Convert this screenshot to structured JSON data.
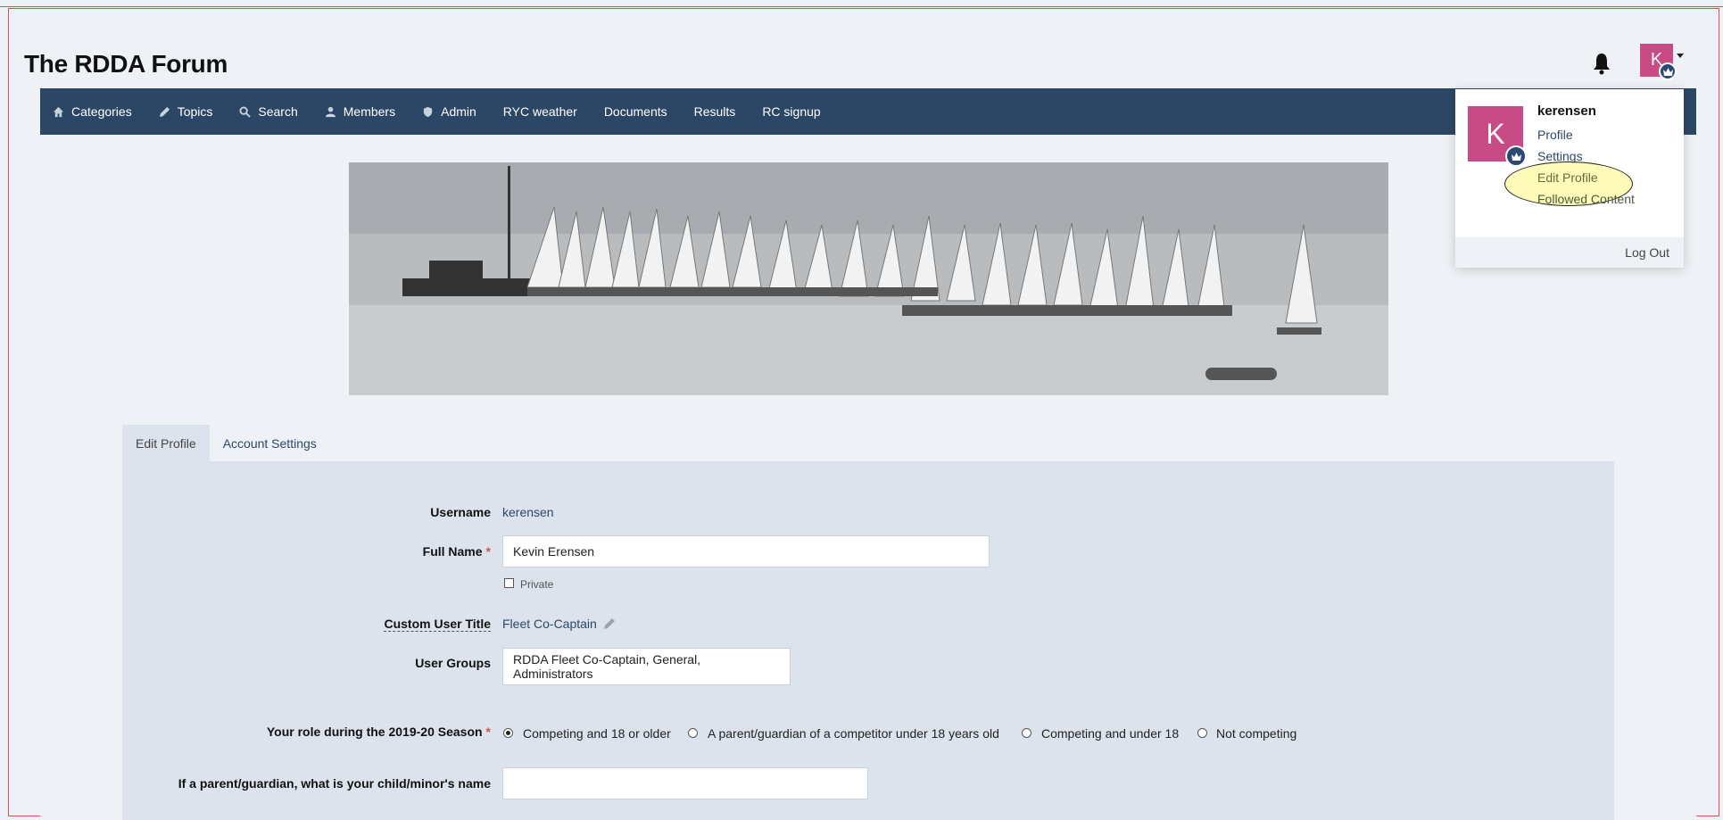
{
  "site": {
    "title": "The RDDA Forum"
  },
  "user": {
    "initial": "K",
    "username": "kerensen"
  },
  "colors": {
    "nav": "#2c4766",
    "avatar": "#c94b86",
    "required": "#d9534f"
  },
  "nav": {
    "items": [
      {
        "label": "Categories",
        "icon": "home-icon"
      },
      {
        "label": "Topics",
        "icon": "pencil-icon"
      },
      {
        "label": "Search",
        "icon": "search-icon"
      },
      {
        "label": "Members",
        "icon": "user-icon"
      },
      {
        "label": "Admin",
        "icon": "shield-icon"
      },
      {
        "label": "RYC weather",
        "icon": ""
      },
      {
        "label": "Documents",
        "icon": ""
      },
      {
        "label": "Results",
        "icon": ""
      },
      {
        "label": "RC signup",
        "icon": ""
      }
    ]
  },
  "dropdown": {
    "username": "kerensen",
    "links": [
      "Profile",
      "Settings",
      "Edit Profile",
      "Followed Content"
    ],
    "logout": "Log Out"
  },
  "tabs": [
    "Edit Profile",
    "Account Settings"
  ],
  "form": {
    "username_label": "Username",
    "username_value": "kerensen",
    "fullname_label": "Full Name",
    "fullname_value": "Kevin Erensen",
    "private_label": "Private",
    "custom_title_label": "Custom User Title",
    "custom_title_value": "Fleet Co-Captain",
    "user_groups_label": "User Groups",
    "user_groups_value": "RDDA Fleet Co-Captain, General, Administrators",
    "role_label": "Your role during the 2019-20 Season",
    "role_options": [
      "Competing and 18 or older",
      "A parent/guardian of a competitor under 18 years old",
      "Competing and under 18",
      "Not competing"
    ],
    "role_selected": "Competing and 18 or older",
    "child_label": "If a parent/guardian, what is your child/minor's name",
    "child_value": "",
    "required_mark": "*"
  }
}
